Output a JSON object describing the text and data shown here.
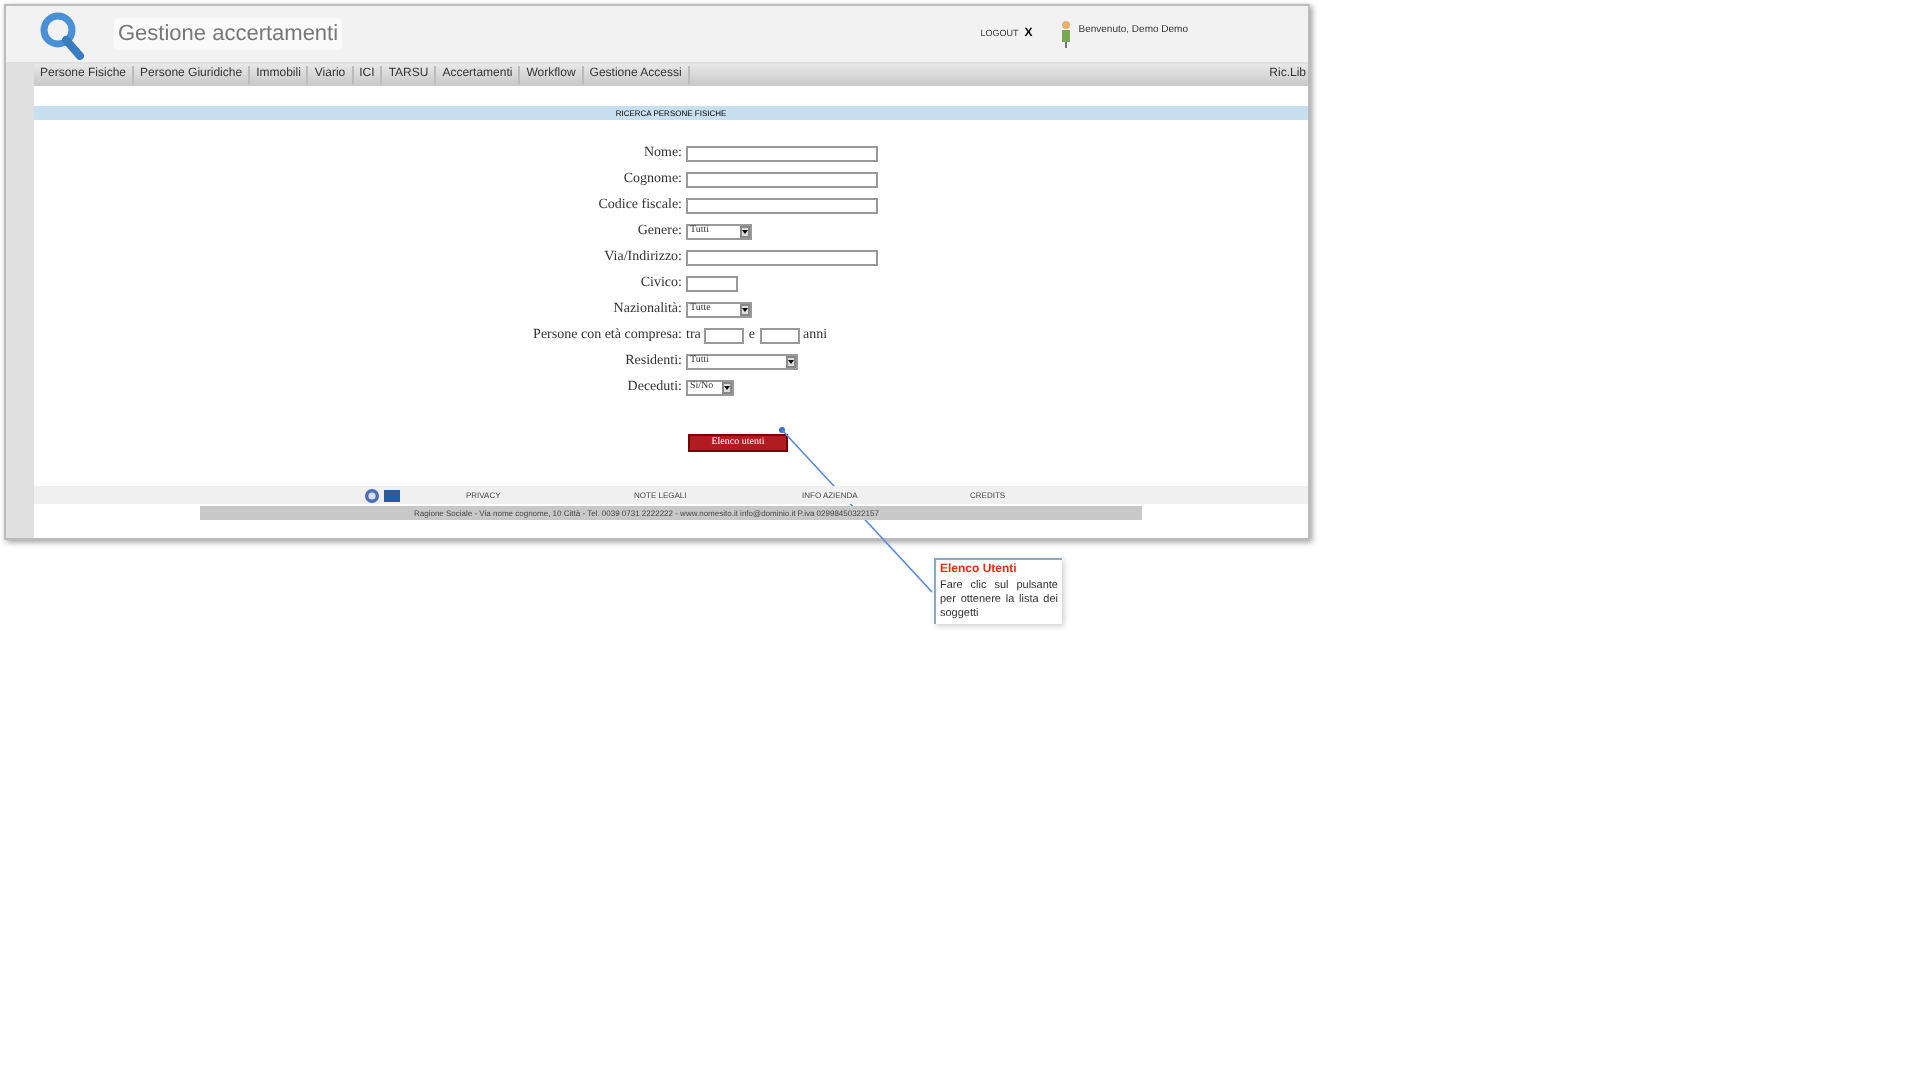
{
  "header": {
    "title": "Gestione accertamenti",
    "logout": "LOGOUT",
    "logout_icon": "X",
    "welcome": "Benvenuto, Demo Demo"
  },
  "nav": {
    "items": [
      "Persone Fisiche",
      "Persone Giuridiche",
      "Immobili",
      "Viario",
      "ICI",
      "TARSU",
      "Accertamenti",
      "Workflow",
      "Gestione Accessi"
    ],
    "right": "Ric.Lib"
  },
  "section_title": "RICERCA PERSONE FISICHE",
  "form": {
    "fields": [
      {
        "kind": "text",
        "label": "Nome:"
      },
      {
        "kind": "text",
        "label": "Cognome:"
      },
      {
        "kind": "text",
        "label": "Codice fiscale:"
      },
      {
        "kind": "select",
        "label": "Genere:",
        "value": "Tutti"
      },
      {
        "kind": "text",
        "label": "Via/Indirizzo:"
      },
      {
        "kind": "text",
        "label": "Civico:"
      },
      {
        "kind": "select",
        "label": "Nazionalità:",
        "value": "Tutte"
      },
      {
        "kind": "range",
        "label": "Persone con età compresa:",
        "prefix": "tra",
        "middle": "e",
        "suffix": "anni"
      },
      {
        "kind": "select",
        "label": "Residenti:",
        "value": "Tutti"
      },
      {
        "kind": "select",
        "label": "Deceduti:",
        "value": "Si/No"
      }
    ],
    "button": "Elenco utenti"
  },
  "footer": {
    "links": [
      "PRIVACY",
      "NOTE LEGALI",
      "INFO AZIENDA",
      "CREDITS"
    ],
    "address": "Ragione Sociale - Via nome cognome, 10 Città - Tel. 0039 0731 2222222 - www.nomesito.it info@dominio.it P.iva 02998450322157"
  },
  "callout": {
    "title": "Elenco Utenti",
    "text": "Fare clic sul pulsante per ottenere la lista dei soggetti"
  }
}
